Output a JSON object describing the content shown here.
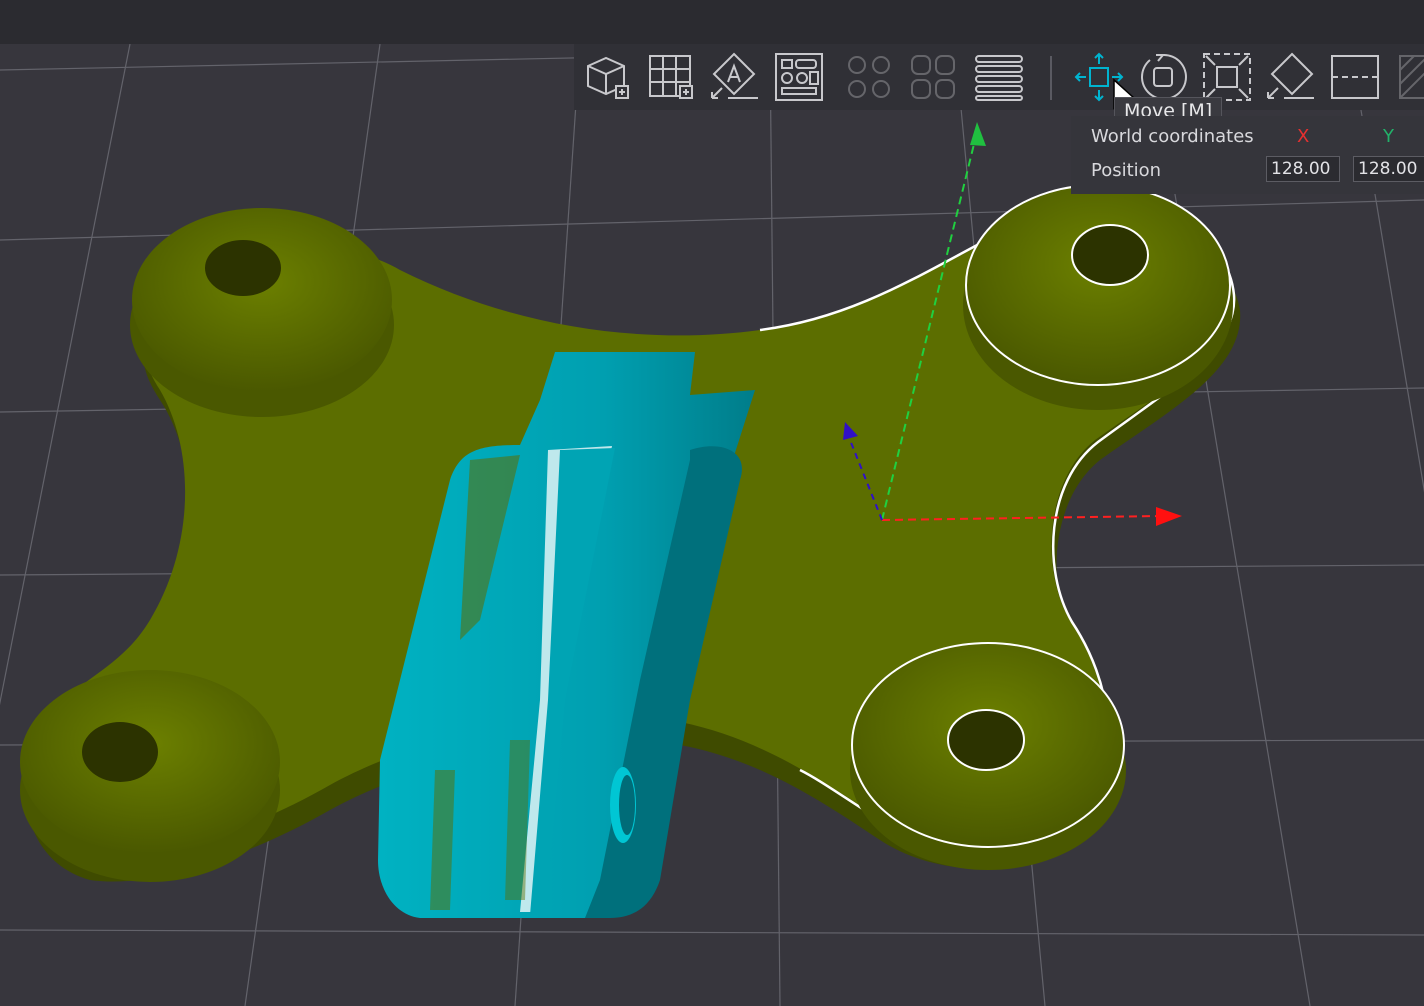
{
  "toolbar": {
    "items": [
      {
        "name": "add-cube-icon",
        "label": "Add",
        "enabled": true
      },
      {
        "name": "add-plate-icon",
        "label": "Add plate",
        "enabled": true
      },
      {
        "name": "auto-orient-icon",
        "label": "Auto orient",
        "enabled": true
      },
      {
        "name": "arrange-icon",
        "label": "Arrange",
        "enabled": true
      },
      {
        "name": "split-objects-icon",
        "label": "Split to objects",
        "enabled": false
      },
      {
        "name": "split-parts-icon",
        "label": "Split to parts",
        "enabled": false
      },
      {
        "name": "variable-layer-icon",
        "label": "Variable layer height",
        "enabled": true
      },
      {
        "name": "move-icon",
        "label": "Move",
        "enabled": true,
        "active": true
      },
      {
        "name": "rotate-icon",
        "label": "Rotate",
        "enabled": true
      },
      {
        "name": "scale-icon",
        "label": "Scale",
        "enabled": true
      },
      {
        "name": "lay-on-face-icon",
        "label": "Lay on face",
        "enabled": true
      },
      {
        "name": "cut-icon",
        "label": "Cut",
        "enabled": true
      }
    ]
  },
  "tooltip": {
    "text": "Move [M]"
  },
  "gizmo_panel": {
    "title": "World coordinates",
    "axis_x_label": "X",
    "axis_y_label": "Y",
    "position_label": "Position",
    "position_x": "128.00",
    "position_y": "128.00"
  },
  "colors": {
    "background": "#37363d",
    "grid": "#6a6a72",
    "model_primary": "#5c6e00",
    "model_selected_part": "#00a8b8",
    "axis_x": "#ff2020",
    "axis_y": "#20d040",
    "axis_z": "#3010c8"
  }
}
